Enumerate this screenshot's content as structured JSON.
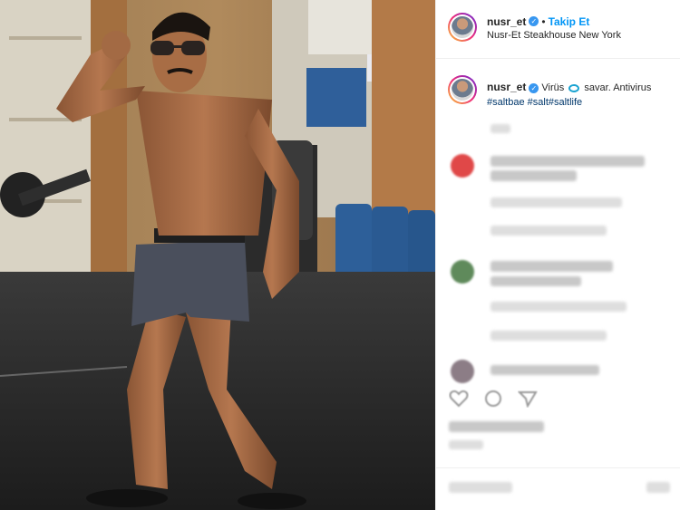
{
  "post": {
    "username": "nusr_et",
    "follow_label": "Takip Et",
    "location": "Nusr-Et Steakhouse New York",
    "caption_part1": "Virüs",
    "caption_part2": "savar. Antivirus",
    "hashtags": "#saltbae #salt#saltlife"
  },
  "colors": {
    "accent": "#0095f6",
    "verified": "#3897f0",
    "hashtag": "#00376b"
  },
  "icons": [
    "verified-badge-icon",
    "heart-icon",
    "comment-icon",
    "share-icon"
  ]
}
